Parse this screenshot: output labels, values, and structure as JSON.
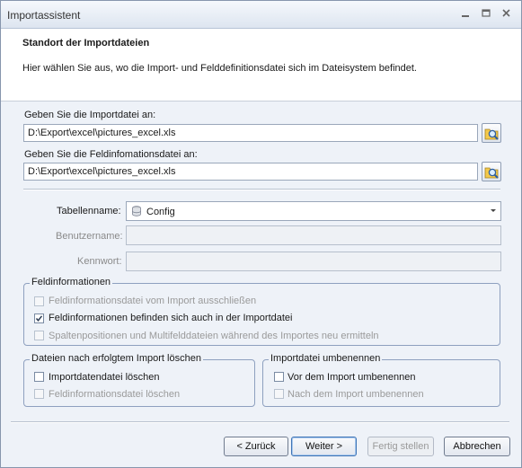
{
  "window": {
    "title": "Importassistent",
    "minimize_icon": "minimize-icon",
    "maximize_icon": "maximize-icon",
    "close_icon": "close-icon"
  },
  "header": {
    "title": "Standort der Importdateien",
    "description": "Hier wählen Sie aus, wo die Import- und Felddefinitionsdatei sich im Dateisystem befindet."
  },
  "import_file": {
    "label": "Geben Sie die Importdatei an:",
    "value": "D:\\Export\\excel\\pictures_excel.xls",
    "browse_icon": "folder-search-icon"
  },
  "field_def_file": {
    "label": "Geben Sie die Feldinfomationsdatei an:",
    "value": "D:\\Export\\excel\\pictures_excel.xls",
    "browse_icon": "folder-search-icon"
  },
  "table": {
    "label": "Tabellenname:",
    "value": "Config",
    "icon": "database-icon"
  },
  "username": {
    "label": "Benutzername:",
    "value": ""
  },
  "password": {
    "label": "Kennwort:",
    "value": ""
  },
  "field_info": {
    "legend": "Feldinformationen",
    "options": [
      {
        "label": "Feldinformationsdatei vom Import ausschließen",
        "checked": false,
        "enabled": false
      },
      {
        "label": "Feldinformationen befinden sich auch in der Importdatei",
        "checked": true,
        "enabled": true
      },
      {
        "label": "Spaltenpositionen und Multifelddateien während des Importes neu ermitteln",
        "checked": false,
        "enabled": false
      }
    ]
  },
  "after_import": {
    "legend": "Dateien nach erfolgtem Import löschen",
    "options": [
      {
        "label": "Importdatendatei löschen",
        "checked": false,
        "enabled": true
      },
      {
        "label": "Feldinformationsdatei löschen",
        "checked": false,
        "enabled": false
      }
    ]
  },
  "rename": {
    "legend": "Importdatei umbenennen",
    "options": [
      {
        "label": "Vor dem Import umbenennen",
        "checked": false,
        "enabled": true
      },
      {
        "label": "Nach dem Import umbenennen",
        "checked": false,
        "enabled": false
      }
    ]
  },
  "buttons": {
    "back": "< Zurück",
    "next": "Weiter >",
    "finish": "Fertig stellen",
    "cancel": "Abbrechen"
  }
}
